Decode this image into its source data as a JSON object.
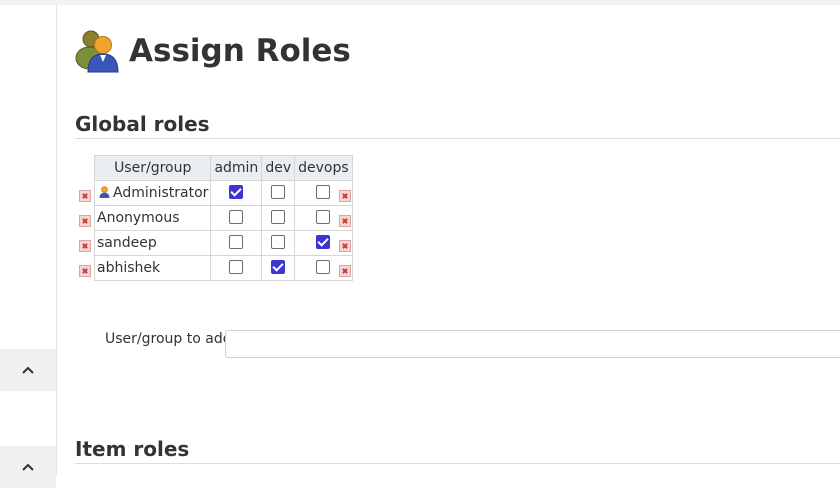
{
  "page": {
    "title": "Assign Roles",
    "icon": "users-icon"
  },
  "global_roles": {
    "heading": "Global roles",
    "columns": [
      "User/group",
      "admin",
      "dev",
      "devops"
    ],
    "rows": [
      {
        "name": "Administrator",
        "icon": "user-icon",
        "checks": [
          true,
          false,
          false
        ]
      },
      {
        "name": "Anonymous",
        "checks": [
          false,
          false,
          false
        ]
      },
      {
        "name": "sandeep",
        "checks": [
          false,
          false,
          true
        ]
      },
      {
        "name": "abhishek",
        "checks": [
          false,
          true,
          false
        ]
      }
    ],
    "add": {
      "label": "User/group to add",
      "value": ""
    }
  },
  "item_roles": {
    "heading": "Item roles"
  },
  "sidebar": {
    "buttons": [
      {
        "icon": "chevron-up-icon"
      },
      {
        "icon": "chevron-up-icon"
      }
    ]
  },
  "colors": {
    "checkbox_checked": "#3d34d4",
    "header_bg": "#e9eef0",
    "delete_icon": "#d23b3b"
  }
}
